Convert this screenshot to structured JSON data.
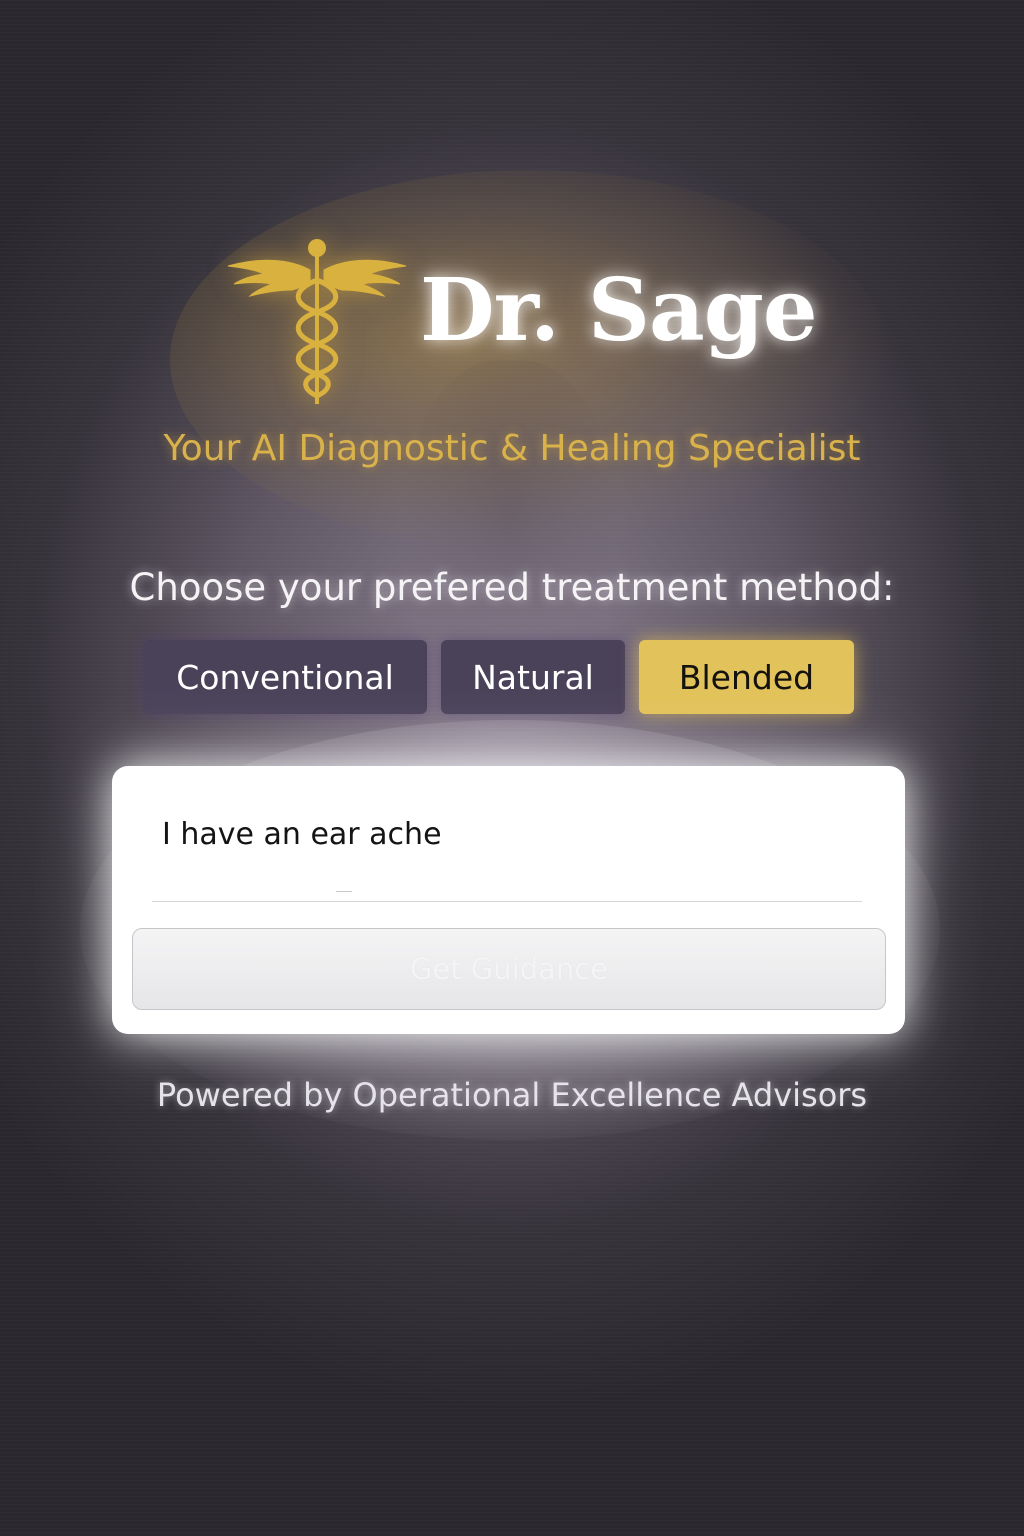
{
  "app": {
    "title": "Dr. Sage",
    "tagline": "Your AI Diagnostic & Healing Specialist",
    "logo_icon": "caduceus-icon"
  },
  "treatment": {
    "prompt": "Choose your prefered treatment method:",
    "options": [
      {
        "label": "Conventional",
        "selected": false
      },
      {
        "label": "Natural",
        "selected": false
      },
      {
        "label": "Blended",
        "selected": true
      }
    ],
    "selected": "Blended"
  },
  "form": {
    "symptom_value": "I have an ear ache",
    "submit_label": "Get Guidance",
    "submit_enabled": false
  },
  "footer": {
    "text": "Powered by Operational Excellence Advisors"
  },
  "colors": {
    "accent_gold": "#e2c25a",
    "tagline_gold": "#d9b24c",
    "option_purple": "#4a4259",
    "background_dark": "#2a282e"
  }
}
